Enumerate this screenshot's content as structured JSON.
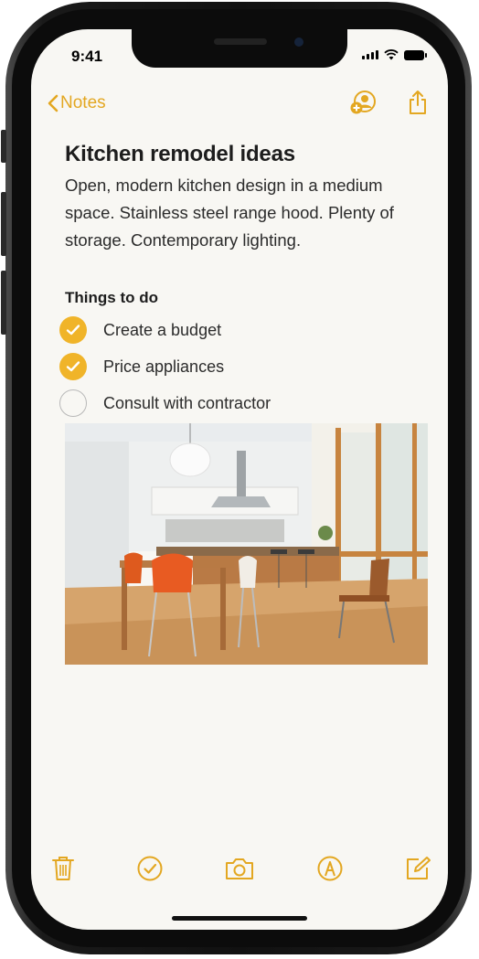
{
  "status_bar": {
    "time": "9:41"
  },
  "nav": {
    "back_label": "Notes"
  },
  "note": {
    "title": "Kitchen remodel ideas",
    "body": "Open, modern kitchen design in a medium space. Stainless steel range hood. Plenty of storage. Contemporary lighting.",
    "section_heading": "Things to do",
    "checklist": [
      {
        "label": "Create a budget",
        "checked": true
      },
      {
        "label": "Price appliances",
        "checked": true
      },
      {
        "label": "Consult with contractor",
        "checked": false
      }
    ]
  },
  "toolbar": {
    "icons": [
      "trash-icon",
      "checklist-icon",
      "camera-icon",
      "markup-icon",
      "compose-icon"
    ]
  },
  "colors": {
    "accent": "#e3a721",
    "check_fill": "#f0b429",
    "paper": "#f8f7f3"
  }
}
